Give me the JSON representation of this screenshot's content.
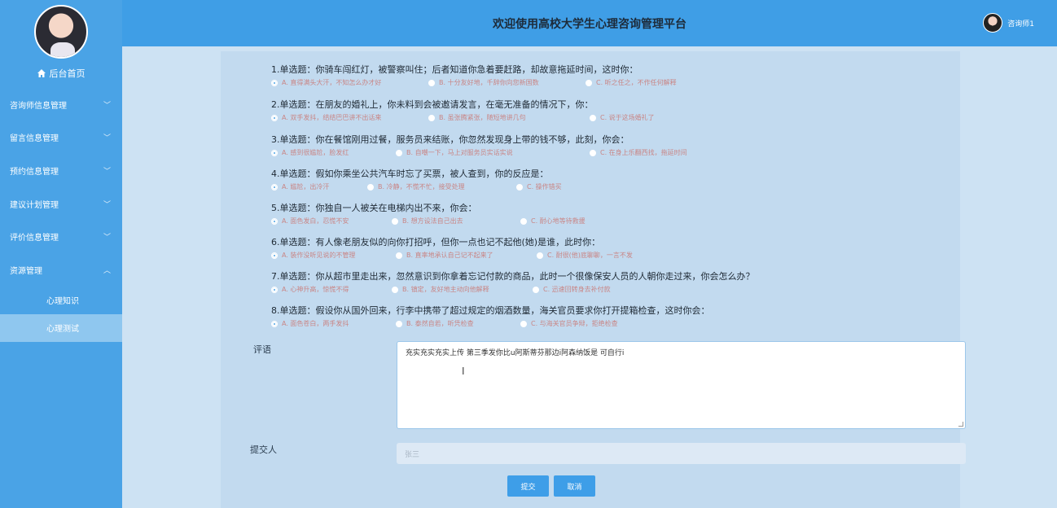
{
  "sidebar": {
    "home_label": "后台首页",
    "menu": [
      {
        "label": "咨询师信息管理",
        "chev": "﹀"
      },
      {
        "label": "留言信息管理",
        "chev": "﹀"
      },
      {
        "label": "预约信息管理",
        "chev": "﹀"
      },
      {
        "label": "建议计划管理",
        "chev": "﹀"
      },
      {
        "label": "评价信息管理",
        "chev": "﹀"
      },
      {
        "label": "资源管理",
        "chev": "︿"
      }
    ],
    "sub": [
      {
        "label": "心理知识"
      },
      {
        "label": "心理测试"
      }
    ]
  },
  "header": {
    "title": "欢迎使用高校大学生心理咨询管理平台",
    "username": "咨询师1"
  },
  "questions": [
    {
      "text": "1.单选题：你骑车闯红灯，被警察叫住；后者知道你急着要赶路，却故意拖延时间，这时你：",
      "options": [
        "A. 直得满头大汗，不知怎么办才好",
        "B. 十分友好地，千辞你向您新国数",
        "C. 听之任之，不作任何解释"
      ]
    },
    {
      "text": "2.单选题：在朋友的婚礼上，你未料到会被邀请发言，在毫无准备的情况下，你：",
      "options": [
        "A. 双手发抖，结结巴巴讲不出话来",
        "B. 虽张腾紧张，随短地讲几句",
        "C. 说于这场婚礼了"
      ]
    },
    {
      "text": "3.单选题：你在餐馆刚用过餐，服务员来结账，你忽然发现身上带的钱不够，此刻，你会：",
      "options": [
        "A. 感到很尴尬，脸发红",
        "B. 自嘲一下，马上对服务员实话实说",
        "C. 在身上乐翻西找，拖延时间"
      ]
    },
    {
      "text": "4.单选题：假如你乘坐公共汽车时忘了买票，被人查到，你的反应是：",
      "options": [
        "A. 尴尬，出冷汗",
        "B. 冷静，不慌不忙，接受处理",
        "C. 操作错买"
      ]
    },
    {
      "text": "5.单选题：你独自一人被关在电梯内出不来，你会：",
      "options": [
        "A. 面色发白，忍慌不安",
        "B. 想方设法自己出去",
        "C. 耐心地等待救援"
      ]
    },
    {
      "text": "6.单选题：有人像老朋友似的向你打招呼，但你一点也记不起他(她)是谁，此时你：",
      "options": [
        "A. 装作没听见说的不管理",
        "B. 直率地承认自己记不起来了",
        "C. 耐很(他)底聊聊，一言不发"
      ]
    },
    {
      "text": "7.单选题：你从超市里走出来，忽然意识到你拿着忘记付款的商品，此时一个很像保安人员的人朝你走过来，你会怎么办？",
      "options": [
        "A. 心神升高，惊慌不得",
        "B. 镇定，友好地主动向他解释",
        "C. 迅速回转身去补付款"
      ]
    },
    {
      "text": "8.单选题：假设你从国外回来，行李中携带了超过规定的烟酒数量，海关官员要求你打开提箱检查，这时你会：",
      "options": [
        "A. 面色苍白，两手发抖",
        "B. 泰然自若，听凭检查",
        "C. 与海关官员争辩，拒绝检查"
      ]
    }
  ],
  "form": {
    "comment_label": "评语",
    "comment_value": "充实充实充实上传 第三季发你比u阿斯蒂芬那边i阿森纳饭是      可自行i",
    "submitter_label": "提交人",
    "submitter_placeholder": "张三",
    "submit_label": "提交",
    "cancel_label": "取消"
  }
}
